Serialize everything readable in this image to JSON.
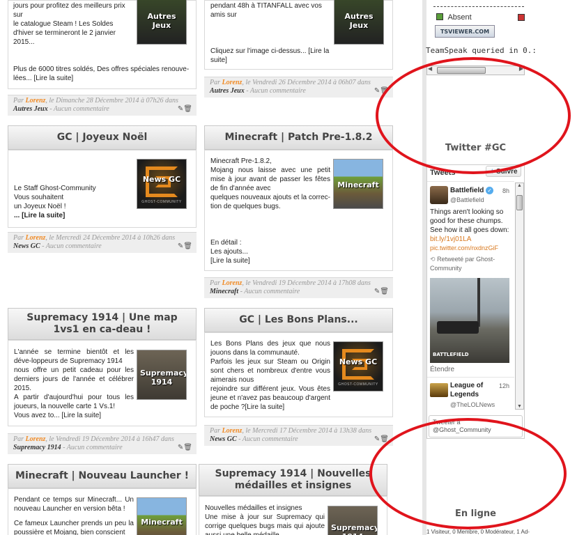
{
  "posts": [
    {
      "key": "autres_jeux",
      "title": "",
      "paragraphs": [
        "jours pour profitez des meilleurs prix sur",
        "le catalogue Steam ! Les Soldes d'hiver se termineront le 2 janvier 2015...",
        "",
        "Plus de 6000 titres soldés, Des offres spéciales renouve-lées... [Lire la suite]"
      ],
      "thumb_label": "Autres Jeux",
      "meta_prefix": "Par",
      "author": "Lorenz",
      "date_text": ", le Dimanche 28 Décembre 2014 à 07h26 dans",
      "category": "Autres Jeux",
      "comments": "- Aucun commentaire"
    },
    {
      "key": "titanfall",
      "title": "",
      "paragraphs": [
        "pendant 48h à TITANFALL avec vos amis sur",
        "",
        "Cliquez sur l'image ci-dessus... [Lire la suite]"
      ],
      "thumb_label": "Autres Jeux",
      "meta_prefix": "Par",
      "author": "Lorenz",
      "date_text": ", le Vendredi 26 Décembre 2014 à 06h07 dans",
      "category": "Autres Jeux",
      "comments": "- Aucun commentaire"
    },
    {
      "key": "joyeux_noel",
      "title": "GC | Joyeux Noël",
      "paragraphs": [
        "Le Staff Ghost-Community",
        "Vous souhaitent",
        "un Joyeux Noël !",
        "... [Lire la suite]"
      ],
      "thumb_label": "News GC",
      "thumb_sub": "GHOST-COMMUNITY",
      "meta_prefix": "Par",
      "author": "Lorenz",
      "date_text": ", le Mercredi 24 Décembre 2014 à 10h26 dans",
      "category": "News GC",
      "comments": "- Aucun commentaire"
    },
    {
      "key": "minecraft_patch",
      "title": "Minecraft | Patch Pre-1.8.2",
      "paragraphs": [
        "Minecraft Pre-1.8.2,",
        "Mojang nous laisse avec une petit mise à jour avant de passer les fêtes de fin d'année avec",
        "quelques nouveaux ajouts et la correc-tion de quelques bugs.",
        "",
        "",
        "En détail :",
        "Les ajouts...",
        "[Lire la suite]"
      ],
      "thumb_label": "Minecraft",
      "meta_prefix": "Par",
      "author": "Lorenz",
      "date_text": ", le Vendredi 19 Décembre 2014 à 17h08 dans",
      "category": "Minecraft",
      "comments": "- Aucun commentaire"
    },
    {
      "key": "supremacy_map",
      "title": "Supremacy 1914 | Une map 1vs1 en ca-deau !",
      "paragraphs": [
        "L'année se termine bientôt et les déve-loppeurs de Supremacy 1914",
        "nous offre un petit cadeau pour les derniers jours de l'année et célébrer 2015.",
        "A partir d'aujourd'hui pour tous les joueurs, la nouvelle carte 1 Vs.1!",
        "Vous avez to... [Lire la suite]"
      ],
      "thumb_label": "Supremacy 1914",
      "meta_prefix": "Par",
      "author": "Lorenz",
      "date_text": ", le Vendredi 19 Décembre 2014 à 16h47 dans",
      "category": "Supremacy 1914",
      "comments": "- Aucun commentaire"
    },
    {
      "key": "bons_plans",
      "title": "GC | Les Bons Plans...",
      "paragraphs": [
        "Les Bons Plans des jeux que nous jouons dans la communauté.",
        "Parfois les jeux sur Steam ou Origin sont chers et nombreux d'entre vous aimerais nous",
        "rejoindre sur différent jeux. Vous êtes jeune et n'avez pas beaucoup d'argent de poche ?[Lire la suite]"
      ],
      "thumb_label": "News GC",
      "thumb_sub": "GHOST-COMMUNITY",
      "meta_prefix": "Par",
      "author": "Lorenz",
      "date_text": ", le Mercredi 17 Décembre 2014 à 13h38 dans",
      "category": "News GC",
      "comments": "- Aucun commentaire"
    },
    {
      "key": "minecraft_launcher",
      "title": "Minecraft | Nouveau Launcher !",
      "paragraphs": [
        "Pendant ce temps sur Minecraft... Un nouveau Launcher en version bêta !",
        "Ce fameux Launcher prends un peu la poussière et Mojang, bien conscient"
      ],
      "thumb_label": "Minecraft"
    },
    {
      "key": "supremacy_medailles",
      "title": "Supremacy 1914 | Nouvelles médailles et insignes",
      "paragraphs": [
        "Nouvelles médailles et insignes",
        "Une mise à jour sur Supremacy qui corrige quelques bugs mais qui ajoute aussi une belle médaille"
      ],
      "thumb_label": "Supremacy 1914"
    }
  ],
  "sidebar": {
    "ts_status": "Absent",
    "ts_viewer_label": "TSVIEWER.COM",
    "ts_queried": "TeamSpeak queried in 0.:",
    "twitter_heading": "Twitter #GC",
    "tweets_label": "Tweets",
    "follow_label": "Suivre",
    "tweet1": {
      "name": "Battlefield",
      "handle": "@Battlefield",
      "time": "8h",
      "text": "Things aren't looking so good for these chumps. See how it all goes down:",
      "link1": "bit.ly/1vj01LA",
      "link2": "pic.twitter.com/nxdnzGiF",
      "retweet": "Retweeté par Ghost-Community",
      "image_label": "BATTLEFIELD",
      "expand": "Étendre"
    },
    "tweet2": {
      "name": "League of Legends",
      "handle": "@TheLOLNews",
      "time": "12h"
    },
    "tweet_to": "Tweeter à @Ghost_Community",
    "online_heading": "En ligne",
    "online_stats": "1 Visiteur, 0 Membre, 0 Modérateur, 1 Ad-"
  },
  "colors": {
    "author": "#f08a24",
    "annotation_ring": "#e0141c",
    "link": "#d9781e"
  }
}
